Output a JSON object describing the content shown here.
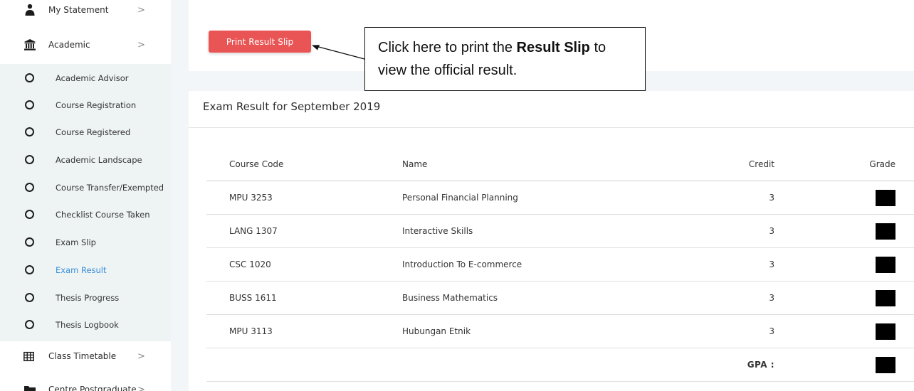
{
  "sidebar": {
    "top_items": [
      {
        "label": "My Statement",
        "icon": "user-icon"
      },
      {
        "label": "Academic",
        "icon": "institution-icon"
      }
    ],
    "sub_items": [
      {
        "label": "Academic Advisor"
      },
      {
        "label": "Course Registration"
      },
      {
        "label": "Course Registered"
      },
      {
        "label": "Academic Landscape"
      },
      {
        "label": "Course Transfer/Exempted"
      },
      {
        "label": "Checklist Course Taken"
      },
      {
        "label": "Exam Slip"
      },
      {
        "label": "Exam Result",
        "active": true
      },
      {
        "label": "Thesis Progress"
      },
      {
        "label": "Thesis Logbook"
      }
    ],
    "bottom_items": [
      {
        "label": "Class Timetable",
        "icon": "table-icon"
      },
      {
        "label": "Centre Postgraduate",
        "icon": "folder-icon"
      }
    ],
    "chevron": ">"
  },
  "print_button": {
    "label": "Print Result Slip"
  },
  "callout": {
    "part1": "Click here to print the ",
    "bold1": "Result",
    "bold2": "Slip",
    "part2": " to view the official result."
  },
  "exam": {
    "title": "Exam Result for September 2019",
    "columns": {
      "code": "Course Code",
      "name": "Name",
      "credit": "Credit",
      "grade": "Grade"
    },
    "rows": [
      {
        "code": "MPU 3253",
        "name": "Personal Financial Planning",
        "credit": "3"
      },
      {
        "code": "LANG 1307",
        "name": "Interactive Skills",
        "credit": "3"
      },
      {
        "code": "CSC 1020",
        "name": "Introduction To E-commerce",
        "credit": "3"
      },
      {
        "code": "BUSS 1611",
        "name": "Business Mathematics",
        "credit": "3"
      },
      {
        "code": "MPU 3113",
        "name": "Hubungan Etnik",
        "credit": "3"
      }
    ],
    "gpa_label": "GPA :"
  },
  "colors": {
    "accent": "#e95555",
    "active_link": "#3a8fd8",
    "submenu_bg": "#eef3f4"
  }
}
